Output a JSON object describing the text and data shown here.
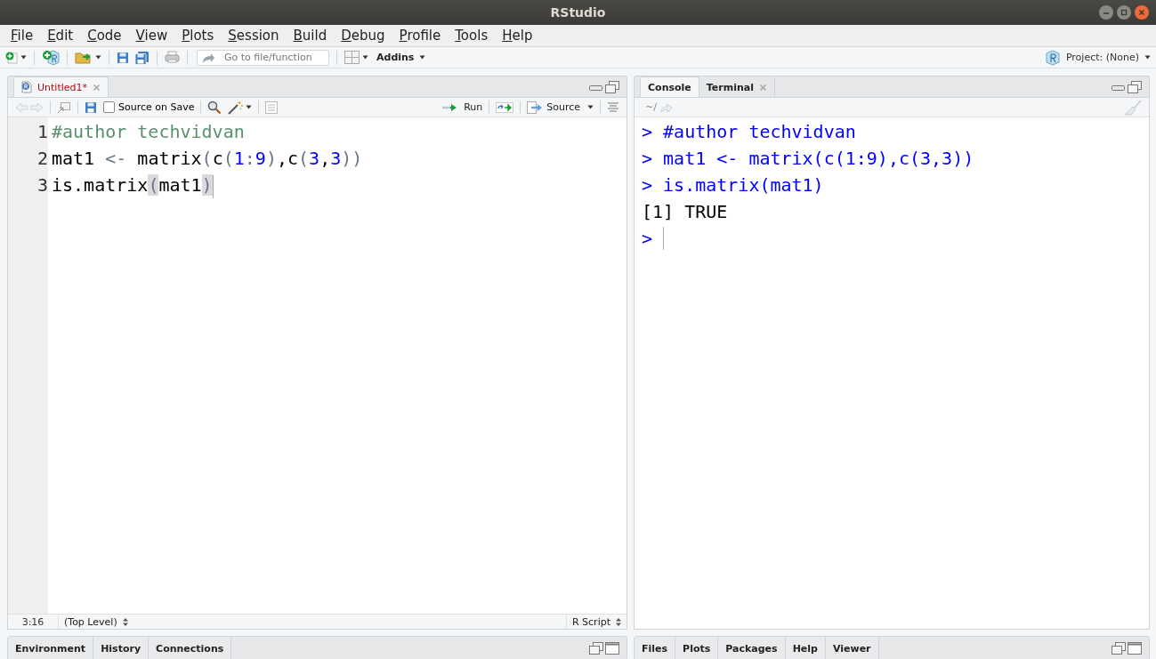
{
  "window": {
    "title": "RStudio"
  },
  "menu": [
    "File",
    "Edit",
    "Code",
    "View",
    "Plots",
    "Session",
    "Build",
    "Debug",
    "Profile",
    "Tools",
    "Help"
  ],
  "toolbar": {
    "goto_placeholder": "Go to file/function",
    "addins": "Addins",
    "project": "Project: (None)"
  },
  "source_pane": {
    "tabs": [
      {
        "label": "Untitled1*",
        "modified": true,
        "selected": true
      }
    ],
    "source_on_save": {
      "label": "Source on Save",
      "checked": false
    },
    "run": "Run",
    "source": "Source",
    "lines": [
      {
        "number": "1",
        "tokens": [
          {
            "kind": "comment",
            "text": "#author techvidvan"
          }
        ]
      },
      {
        "number": "2",
        "tokens": [
          {
            "kind": "plain",
            "text": "mat1 "
          },
          {
            "kind": "operator",
            "text": "<-"
          },
          {
            "kind": "plain",
            "text": " matrix"
          },
          {
            "kind": "paren",
            "text": "("
          },
          {
            "kind": "plain",
            "text": "c"
          },
          {
            "kind": "paren",
            "text": "("
          },
          {
            "kind": "number",
            "text": "1"
          },
          {
            "kind": "operator",
            "text": ":"
          },
          {
            "kind": "number",
            "text": "9"
          },
          {
            "kind": "paren",
            "text": ")"
          },
          {
            "kind": "plain",
            "text": ",c"
          },
          {
            "kind": "paren",
            "text": "("
          },
          {
            "kind": "number",
            "text": "3"
          },
          {
            "kind": "plain",
            "text": ","
          },
          {
            "kind": "number",
            "text": "3"
          },
          {
            "kind": "paren",
            "text": "))"
          }
        ]
      },
      {
        "number": "3",
        "tokens": [
          {
            "kind": "plain",
            "text": "is.matrix"
          },
          {
            "kind": "paren_match",
            "text": "("
          },
          {
            "kind": "plain",
            "text": "mat1"
          },
          {
            "kind": "paren_match",
            "text": ")"
          }
        ]
      }
    ],
    "status": {
      "position": "3:16",
      "scope": "(Top Level)",
      "file_type": "R Script"
    }
  },
  "console_pane": {
    "tabs": [
      {
        "label": "Console",
        "selected": true,
        "closable": false
      },
      {
        "label": "Terminal",
        "selected": false,
        "closable": true
      }
    ],
    "path": "~/",
    "lines": [
      {
        "kind": "input",
        "prompt": ">",
        "text": "#author techvidvan"
      },
      {
        "kind": "input",
        "prompt": ">",
        "text": "mat1 <- matrix(c(1:9),c(3,3))"
      },
      {
        "kind": "input",
        "prompt": ">",
        "text": "is.matrix(mat1)"
      },
      {
        "kind": "output",
        "text": "[1] TRUE"
      },
      {
        "kind": "input",
        "prompt": ">"
      }
    ]
  },
  "environment_pane": {
    "tabs": [
      "Environment",
      "History",
      "Connections"
    ]
  },
  "files_pane": {
    "tabs": [
      "Files",
      "Plots",
      "Packages",
      "Help",
      "Viewer"
    ]
  }
}
